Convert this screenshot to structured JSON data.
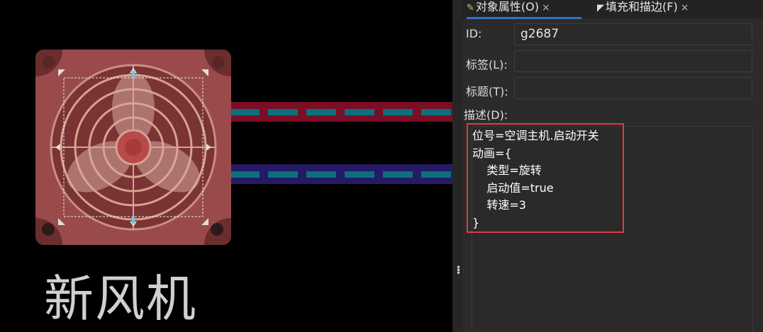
{
  "canvas": {
    "caption": "新风机",
    "fan_icon": "fan-icon",
    "colors": {
      "fan_body": "#9a4a4a",
      "pipe_red": "#7a0e24",
      "pipe_blue": "#241a66",
      "dash": "#0d6f7d"
    }
  },
  "panel": {
    "tabs": [
      {
        "label": "对象属性(O)",
        "close": "×",
        "icon": "object-properties-icon"
      },
      {
        "label": "填充和描边(F)",
        "close": "×",
        "icon": "fill-stroke-icon"
      }
    ],
    "id_label": "ID:",
    "id_value": "g2687",
    "label_label": "标签(L):",
    "label_value": "",
    "title_label": "标题(T):",
    "title_value": "",
    "desc_label": "描述(D):",
    "description": "位号=空调主机.启动开关\n动画={\n    类型=旋转\n    启动值=true\n    转速=3\n}",
    "accent_color": "#2f73c4",
    "highlight_color": "#e5393f"
  }
}
